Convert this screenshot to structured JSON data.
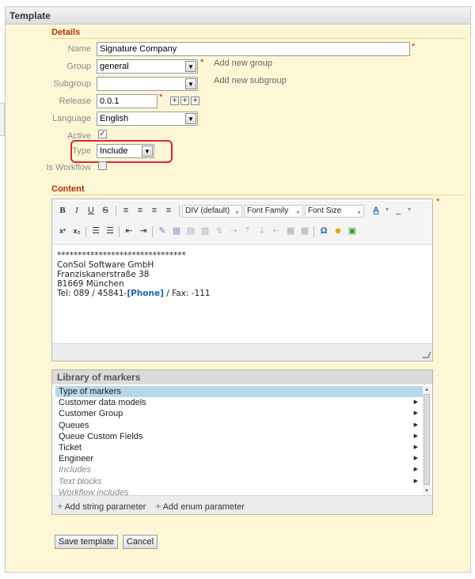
{
  "panel": {
    "title": "Template"
  },
  "details": {
    "section_title": "Details",
    "name": {
      "label": "Name",
      "value": "Signature Company"
    },
    "group": {
      "label": "Group",
      "value": "general",
      "link": "Add new group"
    },
    "subgroup": {
      "label": "Subgroup",
      "value": "",
      "link": "Add new subgroup"
    },
    "release": {
      "label": "Release",
      "value": "0.0.1"
    },
    "language": {
      "label": "Language",
      "value": "English"
    },
    "active": {
      "label": "Active",
      "checked": true
    },
    "type": {
      "label": "Type",
      "value": "Include"
    },
    "is_workflow": {
      "label": "Is Workflow",
      "checked": false
    },
    "required_mark": "*"
  },
  "content": {
    "section_title": "Content",
    "toolbar": {
      "format_select": "DIV (default)",
      "font_family": "Font Family",
      "font_size": "Font Size"
    },
    "body": {
      "line1": "*******************************",
      "line2": "ConSol Software GmbH",
      "line3": "Franziskanerstraße 38",
      "line4": "81669 München",
      "line5_prefix": "Tel: 089 / 45841-",
      "line5_phone": "[Phone]",
      "line5_suffix": " / Fax: -111"
    }
  },
  "library": {
    "title": "Library of markers",
    "items": [
      {
        "label": "Type of markers",
        "selected": true,
        "has_arrow": false,
        "italic": false
      },
      {
        "label": "Customer data models",
        "selected": false,
        "has_arrow": true,
        "italic": false
      },
      {
        "label": "Customer Group",
        "selected": false,
        "has_arrow": true,
        "italic": false
      },
      {
        "label": "Queues",
        "selected": false,
        "has_arrow": true,
        "italic": false
      },
      {
        "label": "Queue Custom Fields",
        "selected": false,
        "has_arrow": true,
        "italic": false
      },
      {
        "label": "Ticket",
        "selected": false,
        "has_arrow": true,
        "italic": false
      },
      {
        "label": "Engineer",
        "selected": false,
        "has_arrow": true,
        "italic": false
      },
      {
        "label": "Includes",
        "selected": false,
        "has_arrow": true,
        "italic": true
      },
      {
        "label": "Text blocks",
        "selected": false,
        "has_arrow": true,
        "italic": true
      },
      {
        "label": "Workflow includes",
        "selected": false,
        "has_arrow": false,
        "italic": true
      }
    ],
    "add_string": "Add string parameter",
    "add_enum": "Add enum parameter"
  },
  "buttons": {
    "save": "Save template",
    "cancel": "Cancel"
  },
  "colors": {
    "panel_bg": "#fdf7d6",
    "section_title": "#b22d00",
    "highlight": "#e1262c",
    "selected_item": "#b7d8e8"
  }
}
